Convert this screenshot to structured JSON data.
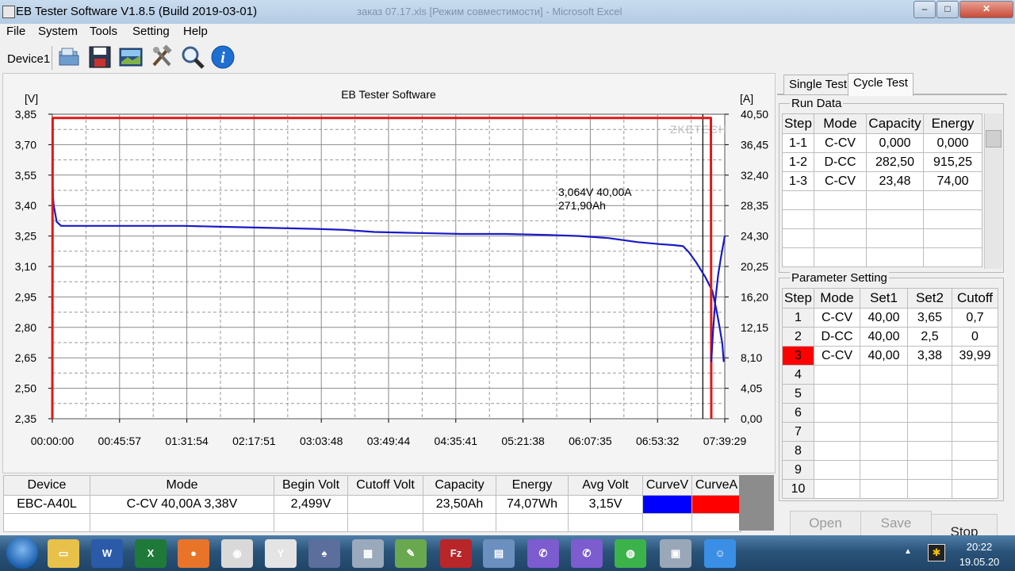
{
  "window": {
    "title": "EB Tester Software V1.8.5 (Build 2019-03-01)",
    "background_title": "заказ 07.17.xls  [Режим совместимости] - Microsoft Excel",
    "buttons": [
      "–",
      "□",
      "✕"
    ]
  },
  "menu": [
    "File",
    "System",
    "Tools",
    "Setting",
    "Help"
  ],
  "toolbar": {
    "device_label": "Device1",
    "icons": [
      "open-folder-icon",
      "save-icon",
      "picture-icon",
      "tools-icon",
      "magnifier-icon",
      "info-icon"
    ]
  },
  "chart": {
    "title": "EB Tester Software",
    "left_unit": "[V]",
    "right_unit": "[A]",
    "watermark": "ZKETECH",
    "annotation_line1": "3,064V  40,00A",
    "annotation_line2": "271,90Ah",
    "left_ticks": [
      "3,85",
      "3,70",
      "3,55",
      "3,40",
      "3,25",
      "3,10",
      "2,95",
      "2,80",
      "2,65",
      "2,50",
      "2,35"
    ],
    "right_ticks": [
      "40,50",
      "36,45",
      "32,40",
      "28,35",
      "24,30",
      "20,25",
      "16,20",
      "12,15",
      "8,10",
      "4,05",
      "0,00"
    ],
    "x_ticks": [
      "00:00:00",
      "00:45:57",
      "01:31:54",
      "02:17:51",
      "03:03:48",
      "03:49:44",
      "04:35:41",
      "05:21:38",
      "06:07:35",
      "06:53:32",
      "07:39:29"
    ],
    "colors": {
      "voltage": "#1a1ac8",
      "current": "#e01818",
      "grid": "#888888",
      "cursor": "#000000"
    }
  },
  "chart_data": {
    "type": "line",
    "title": "EB Tester Software",
    "xlabel": "",
    "ylabel": "[V]",
    "ylabel_right": "[A]",
    "x_unit": "minutes",
    "xlim": [
      0,
      459.5
    ],
    "ylim": [
      2.35,
      3.85
    ],
    "ylim_right": [
      0,
      40.5
    ],
    "grid": true,
    "series": [
      {
        "axis": "left",
        "color": "#1a1ac8",
        "points": [
          [
            0,
            3.55
          ],
          [
            0.5,
            3.44
          ],
          [
            1,
            3.4
          ],
          [
            3,
            3.32
          ],
          [
            6,
            3.3
          ],
          [
            30,
            3.3
          ],
          [
            60,
            3.3
          ],
          [
            90,
            3.3
          ],
          [
            120,
            3.295
          ],
          [
            150,
            3.29
          ],
          [
            180,
            3.285
          ],
          [
            200,
            3.28
          ],
          [
            220,
            3.27
          ],
          [
            250,
            3.265
          ],
          [
            280,
            3.26
          ],
          [
            310,
            3.26
          ],
          [
            340,
            3.255
          ],
          [
            360,
            3.25
          ],
          [
            380,
            3.24
          ],
          [
            400,
            3.22
          ],
          [
            415,
            3.21
          ],
          [
            425,
            3.205
          ],
          [
            431,
            3.2
          ],
          [
            435,
            3.17
          ],
          [
            440,
            3.12
          ],
          [
            446,
            3.05
          ],
          [
            451,
            2.98
          ],
          [
            454,
            2.88
          ],
          [
            456,
            2.8
          ],
          [
            457.8,
            2.72
          ],
          [
            458.8,
            2.63
          ]
        ]
      },
      {
        "axis": "right",
        "color": "#e01818",
        "points": [
          [
            0,
            0
          ],
          [
            0.2,
            40
          ],
          [
            450,
            40
          ],
          [
            450.3,
            0
          ]
        ]
      }
    ],
    "cursor_x": 444.5,
    "annotations": [
      "3,064V  40,00A",
      "271,90Ah"
    ]
  },
  "bottom_table": {
    "headers": [
      "Device",
      "Mode",
      "Begin Volt",
      "Cutoff Volt",
      "Capacity",
      "Energy",
      "Avg Volt",
      "CurveV",
      "CurveA"
    ],
    "rows": [
      [
        "EBC-A40L",
        "C-CV  40,00A  3,38V",
        "2,499V",
        "",
        "23,50Ah",
        "74,07Wh",
        "3,15V",
        "",
        ""
      ]
    ],
    "curve_colors": [
      "#0000ff",
      "#ff0000"
    ]
  },
  "tabs": [
    "Single Test",
    "Cycle Test"
  ],
  "run_data": {
    "label": "Run Data",
    "headers": [
      "Step",
      "Mode",
      "Capacity",
      "Energy"
    ],
    "rows": [
      [
        "1-1",
        "C-CV",
        "0,000",
        "0,000"
      ],
      [
        "1-2",
        "D-CC",
        "282,50",
        "915,25"
      ],
      [
        "1-3",
        "C-CV",
        "23,48",
        "74,00"
      ]
    ]
  },
  "param_setting": {
    "label": "Parameter Setting",
    "headers": [
      "Step",
      "Mode",
      "Set1",
      "Set2",
      "Cutoff"
    ],
    "rows": [
      [
        "1",
        "C-CV",
        "40,00",
        "3,65",
        "0,7"
      ],
      [
        "2",
        "D-CC",
        "40,00",
        "2,5",
        "0"
      ],
      [
        "3",
        "C-CV",
        "40,00",
        "3,38",
        "39,99"
      ],
      [
        "4",
        "",
        "",
        "",
        ""
      ],
      [
        "5",
        "",
        "",
        "",
        ""
      ],
      [
        "6",
        "",
        "",
        "",
        ""
      ],
      [
        "7",
        "",
        "",
        "",
        ""
      ],
      [
        "8",
        "",
        "",
        "",
        ""
      ],
      [
        "9",
        "",
        "",
        "",
        ""
      ],
      [
        "10",
        "",
        "",
        "",
        ""
      ]
    ],
    "active_step": "3"
  },
  "buttons": {
    "open": "Open",
    "save": "Save",
    "stop": "Stop"
  },
  "taskbar": {
    "time": "20:22",
    "date": "19.05.20",
    "apps": [
      {
        "name": "explorer-icon",
        "color": "#e8c14a",
        "glyph": "▭"
      },
      {
        "name": "word-icon",
        "color": "#2a5aa8",
        "glyph": "W"
      },
      {
        "name": "excel-icon",
        "color": "#1f7a3a",
        "glyph": "X"
      },
      {
        "name": "firefox-icon",
        "color": "#e8742a",
        "glyph": "●"
      },
      {
        "name": "chrome-icon",
        "color": "#d9d9d9",
        "glyph": "◉"
      },
      {
        "name": "yandex-icon",
        "color": "#e4e4e4",
        "glyph": "Y"
      },
      {
        "name": "app-icon",
        "color": "#5b6e9c",
        "glyph": "♠"
      },
      {
        "name": "calculator-icon",
        "color": "#9aa9bb",
        "glyph": "▦"
      },
      {
        "name": "notepad-icon",
        "color": "#6aa84f",
        "glyph": "✎"
      },
      {
        "name": "filezilla-icon",
        "color": "#b8262a",
        "glyph": "Fz"
      },
      {
        "name": "eb-tester-icon",
        "color": "#6b8fbf",
        "glyph": "▤"
      },
      {
        "name": "viber-icon",
        "color": "#7c5ccf",
        "glyph": "✆"
      },
      {
        "name": "viber-icon-2",
        "color": "#7c5ccf",
        "glyph": "✆"
      },
      {
        "name": "wechat-icon",
        "color": "#3cb34a",
        "glyph": "◍"
      },
      {
        "name": "virtualbox-icon",
        "color": "#9aa7b8",
        "glyph": "▣"
      },
      {
        "name": "qq-icon",
        "color": "#3a8ee6",
        "glyph": "☺"
      }
    ]
  }
}
